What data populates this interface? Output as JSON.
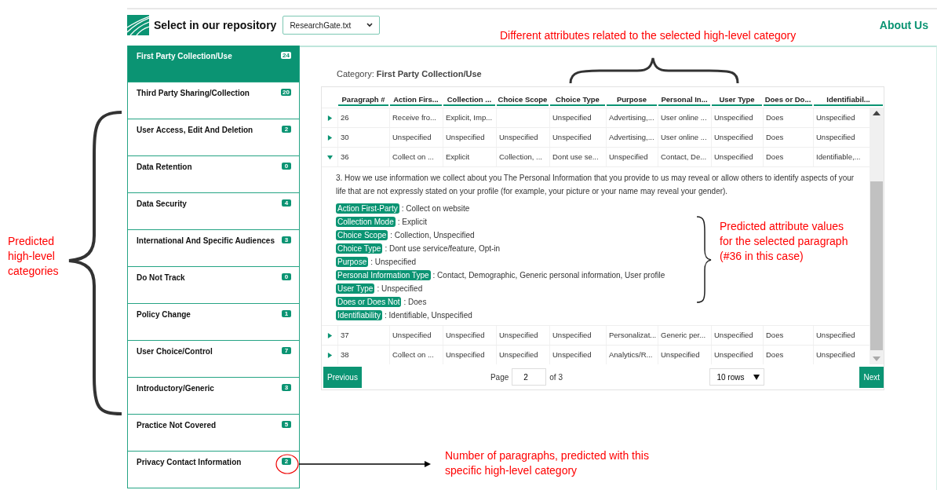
{
  "header": {
    "title": "Select in our repository",
    "repository_select": "ResearchGate.txt",
    "about_link": "About Us"
  },
  "sidebar": {
    "items": [
      {
        "label": "First Party Collection/Use",
        "count": "24",
        "selected": true
      },
      {
        "label": "Third Party Sharing/Collection",
        "count": "20",
        "selected": false
      },
      {
        "label": "User Access, Edit And Deletion",
        "count": "2",
        "selected": false
      },
      {
        "label": "Data Retention",
        "count": "0",
        "selected": false
      },
      {
        "label": "Data Security",
        "count": "4",
        "selected": false
      },
      {
        "label": "International And Specific Audiences",
        "count": "3",
        "selected": false
      },
      {
        "label": "Do Not Track",
        "count": "0",
        "selected": false
      },
      {
        "label": "Policy Change",
        "count": "1",
        "selected": false
      },
      {
        "label": "User Choice/Control",
        "count": "7",
        "selected": false
      },
      {
        "label": "Introductory/Generic",
        "count": "3",
        "selected": false
      },
      {
        "label": "Practice Not Covered",
        "count": "5",
        "selected": false
      },
      {
        "label": "Privacy Contact Information",
        "count": "2",
        "selected": false
      }
    ]
  },
  "category": {
    "label": "Category:",
    "value": "First Party Collection/Use"
  },
  "table": {
    "columns": [
      "Paragraph #",
      "Action Firs...",
      "Collection ...",
      "Choice Scope",
      "Choice Type",
      "Purpose",
      "Personal In...",
      "User Type",
      "Does or Do...",
      "Identifiabil..."
    ],
    "rows": [
      {
        "expanded": false,
        "cells": [
          "26",
          "Receive fro...",
          "Explicit, Imp...",
          "",
          "Unspecified",
          "Advertising,...",
          "User online ...",
          "Unspecified",
          "Does",
          "Unspecified"
        ]
      },
      {
        "expanded": false,
        "cells": [
          "30",
          "Unspecified",
          "Unspecified",
          "Unspecified",
          "Unspecified",
          "Advertising,...",
          "User online ...",
          "Unspecified",
          "Does",
          "Unspecified"
        ]
      },
      {
        "expanded": true,
        "cells": [
          "36",
          "Collect on ...",
          "Explicit",
          "Collection, ...",
          "Dont use se...",
          "Unspecified",
          "Contact, De...",
          "Unspecified",
          "Does",
          "Identifiable,..."
        ],
        "detail": {
          "paragraph": "3. How we use information we collect about you The Personal Information that you provide to us may reveal or allow others to identify aspects of your life that are not expressly stated on your profile (for example, your picture or your name may reveal your gender).",
          "attributes": [
            {
              "name": "Action First-Party",
              "value": ": Collect on website"
            },
            {
              "name": "Collection Mode",
              "value": ": Explicit"
            },
            {
              "name": "Choice Scope",
              "value": ": Collection, Unspecified"
            },
            {
              "name": "Choice Type",
              "value": ": Dont use service/feature, Opt-in"
            },
            {
              "name": "Purpose",
              "value": ": Unspecified"
            },
            {
              "name": "Personal Information Type",
              "value": ": Contact, Demographic, Generic personal information, User profile"
            },
            {
              "name": "User Type",
              "value": ": Unspecified"
            },
            {
              "name": "Does or Does Not",
              "value": ": Does"
            },
            {
              "name": "Identifiability",
              "value": ": Identifiable, Unspecified"
            }
          ]
        }
      },
      {
        "expanded": false,
        "cells": [
          "37",
          "Unspecified",
          "Unspecified",
          "Unspecified",
          "Unspecified",
          "Personalizat...",
          "Generic per...",
          "Unspecified",
          "Does",
          "Unspecified"
        ]
      },
      {
        "expanded": false,
        "cells": [
          "38",
          "Collect on ...",
          "Unspecified",
          "Unspecified",
          "Unspecified",
          "Analytics/R...",
          "Unspecified",
          "Unspecified",
          "Does",
          "Unspecified"
        ]
      }
    ]
  },
  "pagination": {
    "previous": "Previous",
    "page_label": "Page",
    "page": "2",
    "of": "of 3",
    "rows_select": "10 rows",
    "next": "Next"
  },
  "annotations": [
    {
      "kind": "brace-top",
      "text": "Different attributes related to the selected high-level category"
    },
    {
      "kind": "brace-left",
      "text": "Predicted high-level categories"
    },
    {
      "kind": "brace-right",
      "text": "Predicted attribute values for the selected paragraph (#36 in this case)"
    },
    {
      "kind": "arrow",
      "text": "Number of paragraphs, predicted with this specific high-level category"
    }
  ]
}
